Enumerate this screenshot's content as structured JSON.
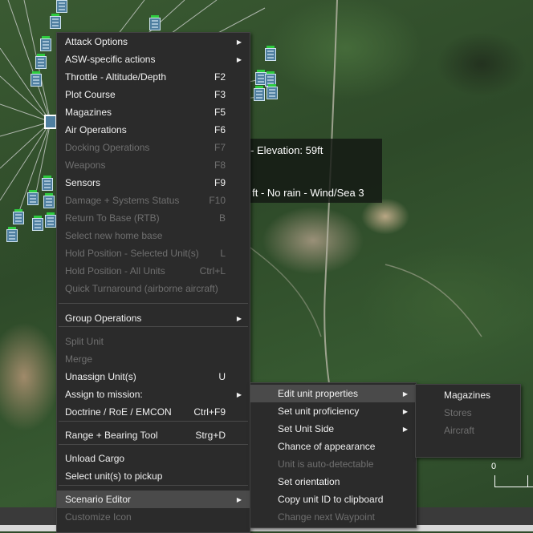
{
  "map": {
    "info_line_1": "- Elevation: 59ft",
    "info_line_2": "k ft - No rain - Wind/Sea 3",
    "scale_label": "0"
  },
  "main_menu": {
    "items": [
      {
        "label": "Attack Options",
        "shortcut": "",
        "submenu": true,
        "disabled": false
      },
      {
        "label": "ASW-specific actions",
        "shortcut": "",
        "submenu": true,
        "disabled": false
      },
      {
        "label": "Throttle - Altitude/Depth",
        "shortcut": "F2",
        "submenu": false,
        "disabled": false
      },
      {
        "label": "Plot Course",
        "shortcut": "F3",
        "submenu": false,
        "disabled": false
      },
      {
        "label": "Magazines",
        "shortcut": "F5",
        "submenu": false,
        "disabled": false
      },
      {
        "label": "Air Operations",
        "shortcut": "F6",
        "submenu": false,
        "disabled": false
      },
      {
        "label": "Docking Operations",
        "shortcut": "F7",
        "submenu": false,
        "disabled": true
      },
      {
        "label": "Weapons",
        "shortcut": "F8",
        "submenu": false,
        "disabled": true
      },
      {
        "label": "Sensors",
        "shortcut": "F9",
        "submenu": false,
        "disabled": false
      },
      {
        "label": "Damage + Systems Status",
        "shortcut": "F10",
        "submenu": false,
        "disabled": true
      },
      {
        "label": "Return To Base (RTB)",
        "shortcut": "B",
        "submenu": false,
        "disabled": true
      },
      {
        "label": "Select new home base",
        "shortcut": "",
        "submenu": false,
        "disabled": true
      },
      {
        "label": "Hold Position - Selected Unit(s)",
        "shortcut": "L",
        "submenu": false,
        "disabled": true
      },
      {
        "label": "Hold Position - All Units",
        "shortcut": "Ctrl+L",
        "submenu": false,
        "disabled": true
      },
      {
        "label": "Quick Turnaround (airborne aircraft)",
        "shortcut": "",
        "submenu": false,
        "disabled": true
      },
      {
        "label": "Group Operations",
        "shortcut": "",
        "submenu": true,
        "disabled": false
      },
      {
        "label": "Split Unit",
        "shortcut": "",
        "submenu": false,
        "disabled": true
      },
      {
        "label": "Merge",
        "shortcut": "",
        "submenu": false,
        "disabled": true
      },
      {
        "label": "Unassign Unit(s)",
        "shortcut": "U",
        "submenu": false,
        "disabled": false
      },
      {
        "label": "Assign to mission:",
        "shortcut": "",
        "submenu": true,
        "disabled": false
      },
      {
        "label": "Doctrine / RoE / EMCON",
        "shortcut": "Ctrl+F9",
        "submenu": false,
        "disabled": false
      },
      {
        "label": "Range + Bearing Tool",
        "shortcut": "Strg+D",
        "submenu": false,
        "disabled": false
      },
      {
        "label": "Unload Cargo",
        "shortcut": "",
        "submenu": false,
        "disabled": false
      },
      {
        "label": "Select unit(s) to pickup",
        "shortcut": "",
        "submenu": false,
        "disabled": false
      },
      {
        "label": "Scenario Editor",
        "shortcut": "",
        "submenu": true,
        "disabled": false,
        "highlighted": true
      },
      {
        "label": "Customize Icon",
        "shortcut": "",
        "submenu": false,
        "disabled": true
      }
    ]
  },
  "scenario_menu": {
    "items": [
      {
        "label": "Edit unit properties",
        "submenu": true,
        "disabled": false,
        "highlighted": true
      },
      {
        "label": "Set unit proficiency",
        "submenu": true,
        "disabled": false
      },
      {
        "label": "Set Unit Side",
        "submenu": true,
        "disabled": false
      },
      {
        "label": "Chance of appearance",
        "submenu": false,
        "disabled": false
      },
      {
        "label": "Unit is auto-detectable",
        "submenu": false,
        "disabled": true
      },
      {
        "label": "Set orientation",
        "submenu": false,
        "disabled": false
      },
      {
        "label": "Copy unit ID to clipboard",
        "submenu": false,
        "disabled": false
      },
      {
        "label": "Change next Waypoint",
        "submenu": false,
        "disabled": true
      }
    ]
  },
  "properties_menu": {
    "items": [
      {
        "label": "Magazines",
        "disabled": false
      },
      {
        "label": "Stores",
        "disabled": true
      },
      {
        "label": "Aircraft",
        "disabled": true
      }
    ]
  },
  "colors": {
    "menu_bg": "#2b2b2b",
    "menu_highlight": "#4a4a4a",
    "disabled_text": "#6f6f6f",
    "unit_blue": "#4f7fa0",
    "unit_status_green": "#2ecc40"
  }
}
